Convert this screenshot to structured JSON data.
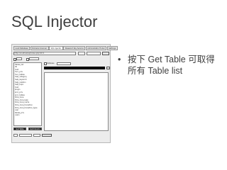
{
  "slide": {
    "title": "SQL Injector",
    "bullet": {
      "symbol": "•",
      "lines": [
        "按下 Get Table 可取得",
        "所有 Table list"
      ]
    }
  },
  "screenshot": {
    "tabs": [
      "Load Database",
      "Domains Scanner",
      "SQL Injector",
      "Password Key Service",
      "Administrator Finder",
      "Settings"
    ],
    "active_tab_index": 2,
    "url_field": "http://localhost/sql/index.php?id=1",
    "get_table_button": "Get Table",
    "left_tables": [
      "Tables_list",
      "db",
      "host",
      "func_priv",
      "func_tables",
      "help_category",
      "help_keyword",
      "help_relation",
      "help_topic",
      "host",
      "plugin",
      "proc_priv",
      "proc_tables",
      "time_zone",
      "time_zone_leap",
      "time_zone_name",
      "time_zone_transition",
      "time_zone_transition_type",
      "user",
      "tables_priv",
      "users"
    ],
    "left_buttons": [
      "Get Table",
      "Get Column"
    ],
    "dbname_label": "Database",
    "colors": {
      "dark_button": "#111111",
      "frame": "#ececec"
    }
  }
}
